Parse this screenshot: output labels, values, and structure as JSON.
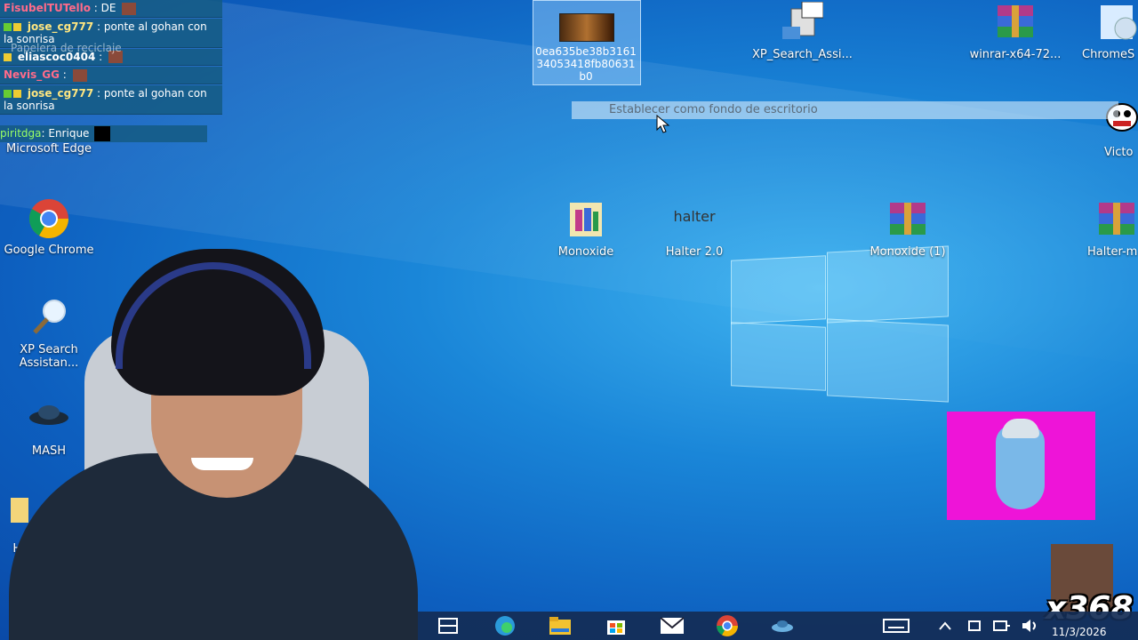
{
  "chat": {
    "messages": [
      {
        "user": "FisubelTUTello",
        "text": ": DE"
      },
      {
        "user": "jose_cg777",
        "text": ": ponte al gohan con la sonrisa"
      },
      {
        "user": "eliascoc0404",
        "text": ":"
      },
      {
        "user": "Nevis_GG",
        "text": ":"
      },
      {
        "user": "jose_cg777",
        "text": ": ponte al gohan con la sonrisa"
      }
    ],
    "last": {
      "user": "piritdga",
      "text": ": Enrique"
    },
    "behind_texts": [
      "Papelera de reciclaje"
    ]
  },
  "desktop": {
    "icons": [
      {
        "label": "Microsoft Edge"
      },
      {
        "label": "Google Chrome"
      },
      {
        "label": "XP Search Assistan..."
      },
      {
        "label": "MASH"
      },
      {
        "label": "Hal"
      },
      {
        "label": "0ea635be38b316134053418fb80631b0"
      },
      {
        "label": "XP_Search_Assi..."
      },
      {
        "label": "winrar-x64-72..."
      },
      {
        "label": "ChromeS"
      },
      {
        "label": "Victo"
      },
      {
        "label": "Monoxide"
      },
      {
        "label": "Halter 2.0"
      },
      {
        "label": "Monoxide (1)"
      },
      {
        "label": "Halter-m"
      }
    ],
    "halter_glyph_text": "halter",
    "context_hint": "Establecer como fondo de escritorio"
  },
  "overlay": {
    "counter": "x368"
  },
  "taskbar": {
    "icons": [
      "task-view-icon",
      "edge-icon",
      "file-explorer-icon",
      "store-icon",
      "mail-icon",
      "chrome-icon",
      "mash-icon"
    ],
    "clock_date": "11/3/2026"
  },
  "colors": {
    "accent": "#1a86d8",
    "taskbar": "#142d55",
    "genie_bg": "#ee14d8"
  }
}
